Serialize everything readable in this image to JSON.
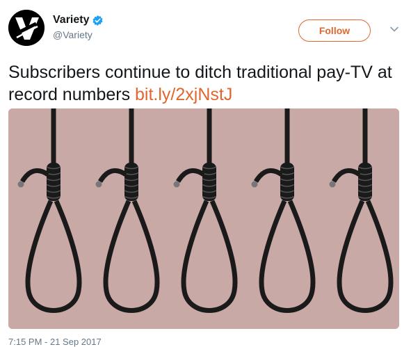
{
  "account": {
    "display_name": "Variety",
    "handle": "@Variety",
    "avatar_icon": "variety-v-logo",
    "verified_icon": "verified-badge-icon"
  },
  "actions": {
    "follow_label": "Follow",
    "menu_icon": "chevron-down-icon"
  },
  "tweet": {
    "text": "Subscribers continue to ditch traditional pay-TV at record numbers",
    "link_text": "bit.ly/2xjNstJ"
  },
  "media": {
    "description_icon": "nooses-image",
    "noose_count": 5
  },
  "timestamp": "7:15 PM - 21 Sep 2017",
  "colors": {
    "accent": "#e0662f",
    "verified": "#1da1f2",
    "image_background": "#c9a9a5",
    "rope": "#1a1a1a"
  }
}
